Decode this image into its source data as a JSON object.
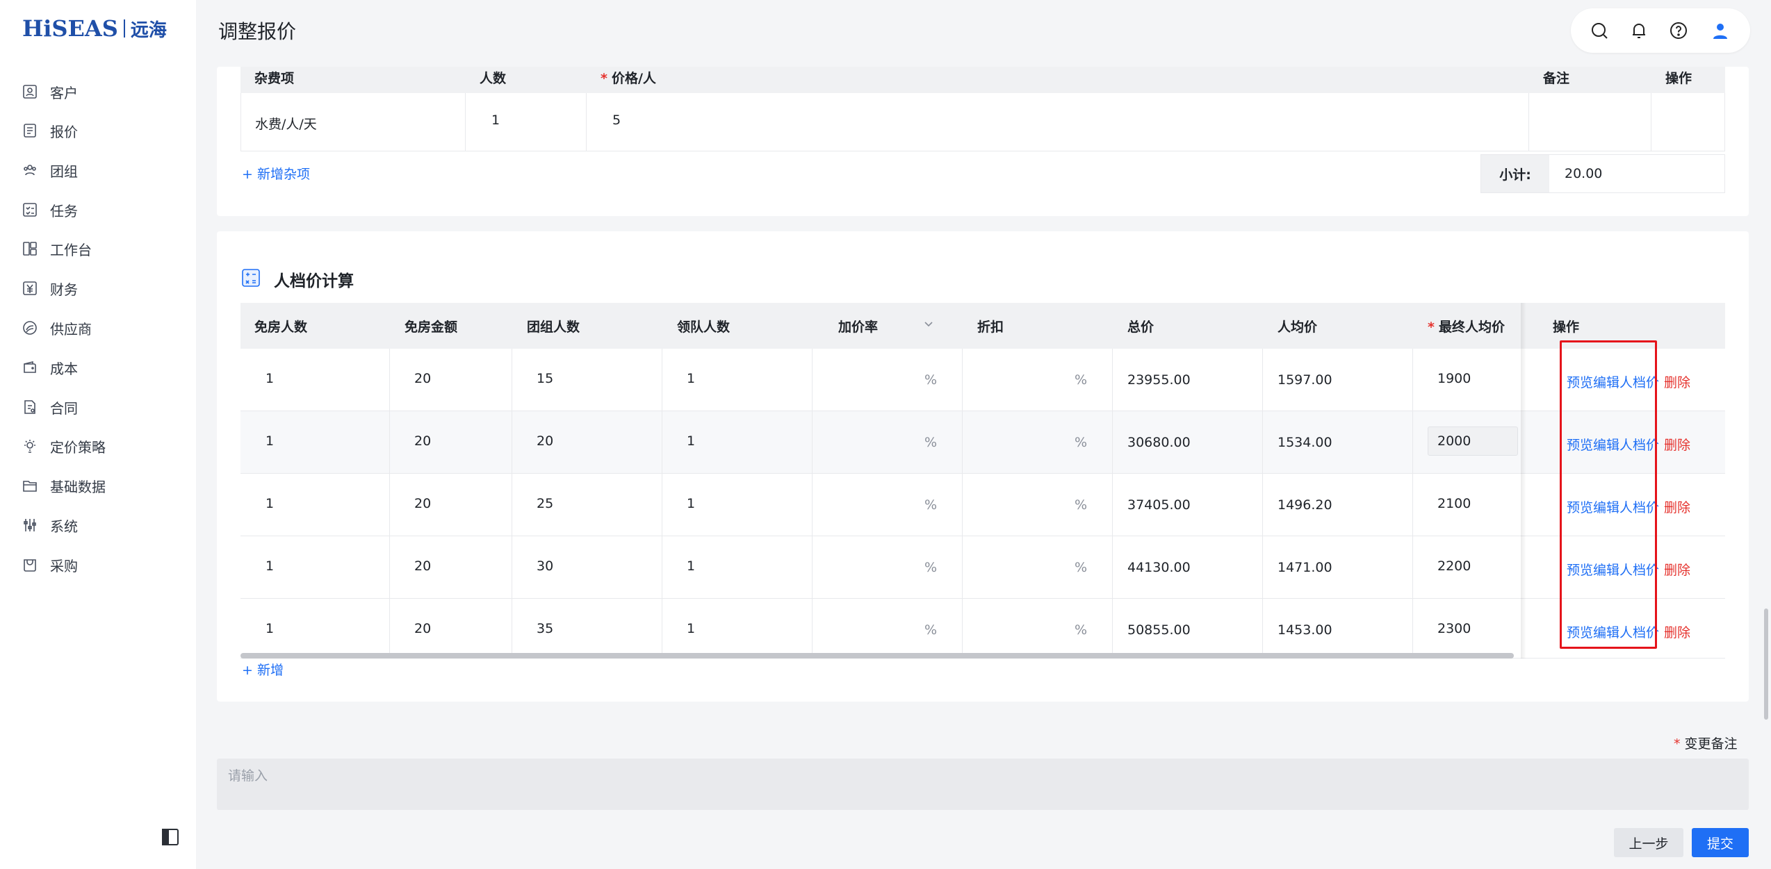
{
  "sidebar": {
    "logo": {
      "brand": "HiSEAS",
      "cn": "远海"
    },
    "items": [
      {
        "label": "客户",
        "icon": "customer-icon"
      },
      {
        "label": "报价",
        "icon": "quote-icon"
      },
      {
        "label": "团组",
        "icon": "group-icon"
      },
      {
        "label": "任务",
        "icon": "task-icon"
      },
      {
        "label": "工作台",
        "icon": "workbench-icon"
      },
      {
        "label": "财务",
        "icon": "finance-icon"
      },
      {
        "label": "供应商",
        "icon": "supplier-icon"
      },
      {
        "label": "成本",
        "icon": "cost-icon"
      },
      {
        "label": "合同",
        "icon": "contract-icon"
      },
      {
        "label": "定价策略",
        "icon": "pricing-strategy-icon"
      },
      {
        "label": "基础数据",
        "icon": "base-data-icon"
      },
      {
        "label": "系统",
        "icon": "system-icon"
      },
      {
        "label": "采购",
        "icon": "purchase-icon"
      }
    ]
  },
  "header": {
    "title": "调整报价",
    "tools": [
      "search-icon",
      "bell-icon",
      "help-icon",
      "user-avatar-icon"
    ]
  },
  "misc": {
    "headers": {
      "item": "杂费项",
      "count": "人数",
      "price": "价格/人",
      "note": "备注",
      "op": "操作"
    },
    "rows": [
      {
        "item": "水费/人/天",
        "count": "1",
        "price": "5",
        "note": ""
      }
    ],
    "add_label": "+ 新增杂项",
    "subtotal_label": "小计:",
    "subtotal_value": "20.00"
  },
  "calc": {
    "title": "人档价计算",
    "headers": [
      "免房人数",
      "免房金额",
      "团组人数",
      "领队人数",
      "加价率",
      "折扣",
      "总价",
      "人均价",
      "最终人均价",
      "操作"
    ],
    "pct": "%",
    "rows": [
      {
        "free_rooms": "1",
        "free_amount": "20",
        "group": "15",
        "leaders": "1",
        "total": "23955.00",
        "avg": "1597.00",
        "final": "1900"
      },
      {
        "free_rooms": "1",
        "free_amount": "20",
        "group": "20",
        "leaders": "1",
        "total": "30680.00",
        "avg": "1534.00",
        "final": "2000"
      },
      {
        "free_rooms": "1",
        "free_amount": "20",
        "group": "25",
        "leaders": "1",
        "total": "37405.00",
        "avg": "1496.20",
        "final": "2100"
      },
      {
        "free_rooms": "1",
        "free_amount": "20",
        "group": "30",
        "leaders": "1",
        "total": "44130.00",
        "avg": "1471.00",
        "final": "2200"
      },
      {
        "free_rooms": "1",
        "free_amount": "20",
        "group": "35",
        "leaders": "1",
        "total": "50855.00",
        "avg": "1453.00",
        "final": "2300"
      }
    ],
    "actions": {
      "edit": "预览编辑人档价",
      "delete": "删除"
    },
    "add_label": "+ 新增"
  },
  "remark": {
    "label": "变更备注",
    "placeholder": "请输入"
  },
  "buttons": {
    "prev": "上一步",
    "submit": "提交"
  },
  "colors": {
    "primary": "#1f6ff5",
    "danger": "#e5322d",
    "highlight": "#e5141b"
  }
}
